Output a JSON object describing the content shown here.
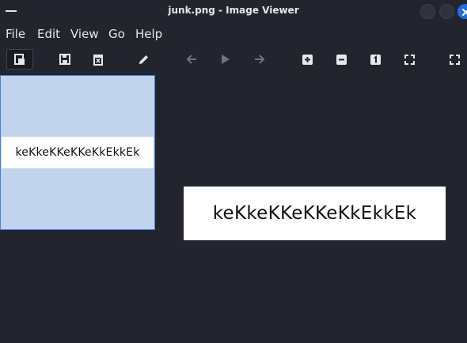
{
  "window": {
    "title": "junk.png - Image Viewer"
  },
  "menu": {
    "file": "File",
    "edit": "Edit",
    "view": "View",
    "go": "Go",
    "help": "Help"
  },
  "toolbar": {
    "icons": [
      "sidebar-toggle-icon",
      "save-icon",
      "delete-icon",
      "edit-pencil-icon",
      "arrow-left-icon",
      "play-icon",
      "arrow-right-icon",
      "zoom-in-icon",
      "zoom-out-icon",
      "zoom-original-icon",
      "fit-window-icon",
      "fullscreen-icon"
    ]
  },
  "thumbnail": {
    "text": "keKkeKKeKKeKkEkkEk"
  },
  "image": {
    "text": "keKkeKKeKKeKkEkkEk"
  },
  "colors": {
    "background": "#22252e",
    "thumbnail_selection": "#c2d3ee",
    "selection_border": "#4a7fd4",
    "close_button": "#1e6fe0"
  }
}
